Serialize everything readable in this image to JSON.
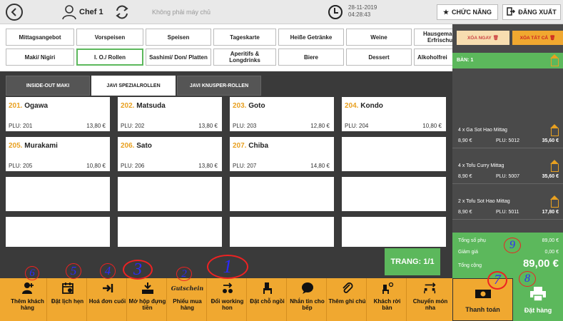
{
  "topbar": {
    "user_name": "Chef 1",
    "server_status": "Không phải máy chủ",
    "date": "28-11-2019",
    "time": "04:28:43",
    "functions_label": "CHỨC NĂNG",
    "logout_label": "ĐĂNG XUẤT"
  },
  "categories": [
    "Mittagsangebot",
    "Vorspeisen",
    "Speisen",
    "Tageskarte",
    "Heiße Getränke",
    "Weine",
    "Hausgemachte Erfrischung",
    "Maki/ Nigiri",
    "I. O./ Rollen",
    "Sashimi/ Don/ Platten",
    "Aperitifs & Longdrinks",
    "Biere",
    "Dessert",
    "Alkoholfrei"
  ],
  "subtabs": [
    "INSIDE-OUT MAKI",
    "JAVI SPEZIALROLLEN",
    "JAVI KNUSPER-ROLLEN"
  ],
  "products": [
    {
      "num": "201.",
      "name": "Ogawa",
      "plu": "PLU: 201",
      "price": "13,80 €"
    },
    {
      "num": "202.",
      "name": "Matsuda",
      "plu": "PLU: 202",
      "price": "13,80 €"
    },
    {
      "num": "203.",
      "name": "Goto",
      "plu": "PLU: 203",
      "price": "12,80 €"
    },
    {
      "num": "204.",
      "name": "Kondo",
      "plu": "PLU: 204",
      "price": "10,80 €"
    },
    {
      "num": "205.",
      "name": "Murakami",
      "plu": "PLU: 205",
      "price": "10,80 €"
    },
    {
      "num": "206.",
      "name": "Sato",
      "plu": "PLU: 206",
      "price": "13,80 €"
    },
    {
      "num": "207.",
      "name": "Chiba",
      "plu": "PLU: 207",
      "price": "14,80 €"
    }
  ],
  "page_indicator": "TRANG: 1/1",
  "order_panel": {
    "clear_now": "XÓA NGAY",
    "clear_all": "XÓA TẤT CẢ",
    "table": "BÀN: 1",
    "items": [
      {
        "qty_name": "4 x Ga Sot Hao Mittag",
        "unit": "8,90 €",
        "plu": "PLU: 5012",
        "total": "35,60 €"
      },
      {
        "qty_name": "4 x Tofu Curry Mittag",
        "unit": "8,90 €",
        "plu": "PLU: 5007",
        "total": "35,60 €"
      },
      {
        "qty_name": "2 x Tofu Sot Hao Mittag",
        "unit": "8,90 €",
        "plu": "PLU: 5011",
        "total": "17,80 €"
      }
    ],
    "subtotal_label": "Tổng số phụ",
    "subtotal": "89,00 €",
    "discount_label": "Giảm giá",
    "discount": "0,00 €",
    "total_label": "Tổng cộng",
    "total": "89,00 €"
  },
  "toolbar": [
    "Thêm khách hàng",
    "Đặt lịch hẹn",
    "Hoá đơn cuối",
    "Mở hộp đựng tiền",
    "Phiếu mua hàng",
    "Đổi working hon",
    "Đặt chỗ ngồi",
    "Nhắn tin cho bếp",
    "Thêm ghi chú",
    "Khách rời bàn",
    "Chuyển món nha"
  ],
  "voucher_logo": "Gutschein",
  "pay_label": "Thanh toán",
  "order_label": "Đặt hàng",
  "annotations": [
    "1",
    "2",
    "3",
    "4",
    "5",
    "6",
    "7",
    "8",
    "9"
  ],
  "colors": {
    "accent_orange": "#f0a830",
    "accent_green": "#5cb85c",
    "dark": "#3a3a3a",
    "price_number": "#e8a020"
  }
}
